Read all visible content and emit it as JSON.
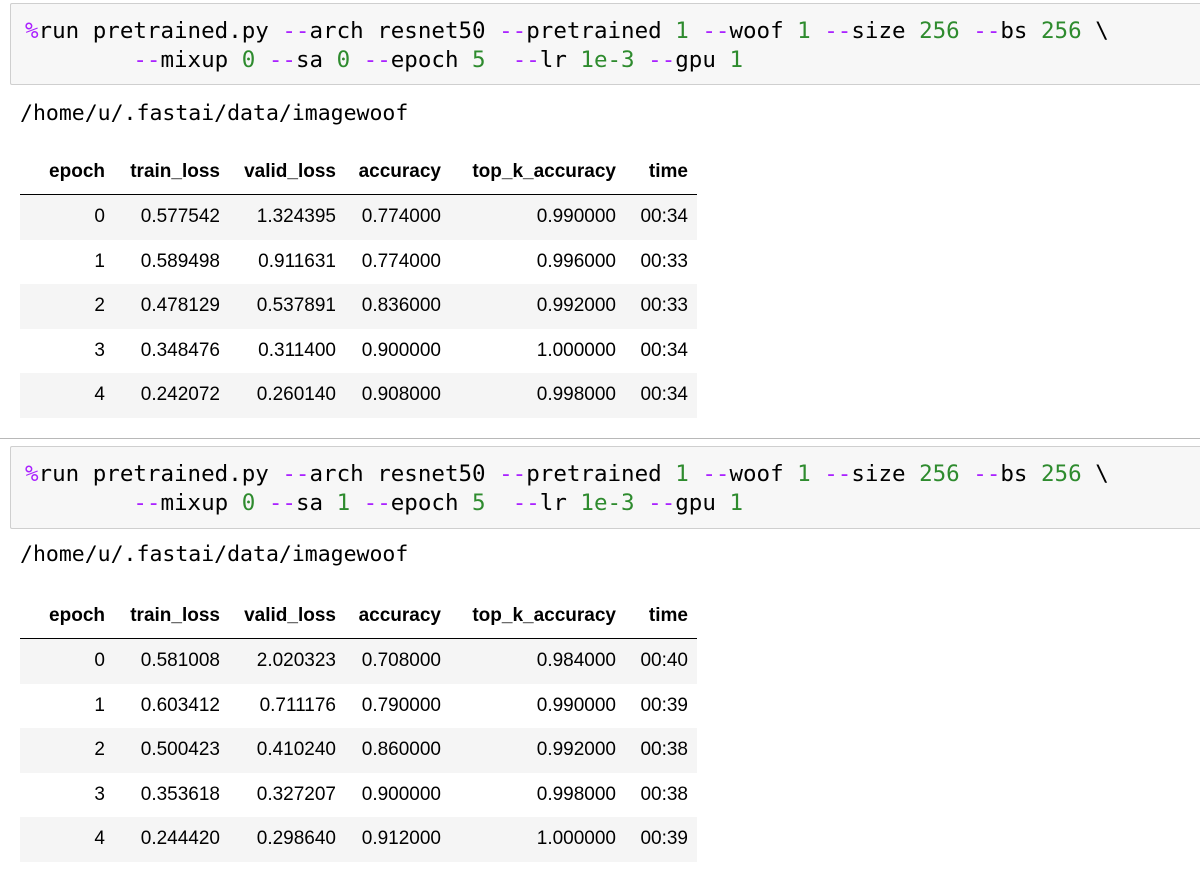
{
  "cells": [
    {
      "command": {
        "line1": [
          {
            "t": "%",
            "c": "magic"
          },
          {
            "t": "run pretrained.py ",
            "c": ""
          },
          {
            "t": "--",
            "c": "op"
          },
          {
            "t": "arch resnet50 ",
            "c": ""
          },
          {
            "t": "--",
            "c": "op"
          },
          {
            "t": "pretrained ",
            "c": ""
          },
          {
            "t": "1",
            "c": "num"
          },
          {
            "t": " ",
            "c": ""
          },
          {
            "t": "--",
            "c": "op"
          },
          {
            "t": "woof ",
            "c": ""
          },
          {
            "t": "1",
            "c": "num"
          },
          {
            "t": " ",
            "c": ""
          },
          {
            "t": "--",
            "c": "op"
          },
          {
            "t": "size ",
            "c": ""
          },
          {
            "t": "256",
            "c": "num"
          },
          {
            "t": " ",
            "c": ""
          },
          {
            "t": "--",
            "c": "op"
          },
          {
            "t": "bs ",
            "c": ""
          },
          {
            "t": "256",
            "c": "num"
          },
          {
            "t": " \\",
            "c": ""
          }
        ],
        "line2": [
          {
            "t": "        ",
            "c": ""
          },
          {
            "t": "--",
            "c": "op"
          },
          {
            "t": "mixup ",
            "c": ""
          },
          {
            "t": "0",
            "c": "num"
          },
          {
            "t": " ",
            "c": ""
          },
          {
            "t": "--",
            "c": "op"
          },
          {
            "t": "sa ",
            "c": ""
          },
          {
            "t": "0",
            "c": "num"
          },
          {
            "t": " ",
            "c": ""
          },
          {
            "t": "--",
            "c": "op"
          },
          {
            "t": "epoch ",
            "c": ""
          },
          {
            "t": "5",
            "c": "num"
          },
          {
            "t": "  ",
            "c": ""
          },
          {
            "t": "--",
            "c": "op"
          },
          {
            "t": "lr ",
            "c": ""
          },
          {
            "t": "1e-3",
            "c": "num"
          },
          {
            "t": " ",
            "c": ""
          },
          {
            "t": "--",
            "c": "op"
          },
          {
            "t": "gpu ",
            "c": ""
          },
          {
            "t": "1",
            "c": "num"
          }
        ]
      },
      "output_path": "/home/u/.fastai/data/imagewoof",
      "table": {
        "headers": [
          "epoch",
          "train_loss",
          "valid_loss",
          "accuracy",
          "top_k_accuracy",
          "time"
        ],
        "rows": [
          [
            "0",
            "0.577542",
            "1.324395",
            "0.774000",
            "0.990000",
            "00:34"
          ],
          [
            "1",
            "0.589498",
            "0.911631",
            "0.774000",
            "0.996000",
            "00:33"
          ],
          [
            "2",
            "0.478129",
            "0.537891",
            "0.836000",
            "0.992000",
            "00:33"
          ],
          [
            "3",
            "0.348476",
            "0.311400",
            "0.900000",
            "1.000000",
            "00:34"
          ],
          [
            "4",
            "0.242072",
            "0.260140",
            "0.908000",
            "0.998000",
            "00:34"
          ]
        ]
      }
    },
    {
      "command": {
        "line1": [
          {
            "t": "%",
            "c": "magic"
          },
          {
            "t": "run pretrained.py ",
            "c": ""
          },
          {
            "t": "--",
            "c": "op"
          },
          {
            "t": "arch resnet50 ",
            "c": ""
          },
          {
            "t": "--",
            "c": "op"
          },
          {
            "t": "pretrained ",
            "c": ""
          },
          {
            "t": "1",
            "c": "num"
          },
          {
            "t": " ",
            "c": ""
          },
          {
            "t": "--",
            "c": "op"
          },
          {
            "t": "woof ",
            "c": ""
          },
          {
            "t": "1",
            "c": "num"
          },
          {
            "t": " ",
            "c": ""
          },
          {
            "t": "--",
            "c": "op"
          },
          {
            "t": "size ",
            "c": ""
          },
          {
            "t": "256",
            "c": "num"
          },
          {
            "t": " ",
            "c": ""
          },
          {
            "t": "--",
            "c": "op"
          },
          {
            "t": "bs ",
            "c": ""
          },
          {
            "t": "256",
            "c": "num"
          },
          {
            "t": " \\",
            "c": ""
          }
        ],
        "line2": [
          {
            "t": "        ",
            "c": ""
          },
          {
            "t": "--",
            "c": "op"
          },
          {
            "t": "mixup ",
            "c": ""
          },
          {
            "t": "0",
            "c": "num"
          },
          {
            "t": " ",
            "c": ""
          },
          {
            "t": "--",
            "c": "op"
          },
          {
            "t": "sa ",
            "c": ""
          },
          {
            "t": "1",
            "c": "num"
          },
          {
            "t": " ",
            "c": ""
          },
          {
            "t": "--",
            "c": "op"
          },
          {
            "t": "epoch ",
            "c": ""
          },
          {
            "t": "5",
            "c": "num"
          },
          {
            "t": "  ",
            "c": ""
          },
          {
            "t": "--",
            "c": "op"
          },
          {
            "t": "lr ",
            "c": ""
          },
          {
            "t": "1e-3",
            "c": "num"
          },
          {
            "t": " ",
            "c": ""
          },
          {
            "t": "--",
            "c": "op"
          },
          {
            "t": "gpu ",
            "c": ""
          },
          {
            "t": "1",
            "c": "num"
          }
        ]
      },
      "output_path": "/home/u/.fastai/data/imagewoof",
      "table": {
        "headers": [
          "epoch",
          "train_loss",
          "valid_loss",
          "accuracy",
          "top_k_accuracy",
          "time"
        ],
        "rows": [
          [
            "0",
            "0.581008",
            "2.020323",
            "0.708000",
            "0.984000",
            "00:40"
          ],
          [
            "1",
            "0.603412",
            "0.711176",
            "0.790000",
            "0.990000",
            "00:39"
          ],
          [
            "2",
            "0.500423",
            "0.410240",
            "0.860000",
            "0.992000",
            "00:38"
          ],
          [
            "3",
            "0.353618",
            "0.327207",
            "0.900000",
            "0.998000",
            "00:38"
          ],
          [
            "4",
            "0.244420",
            "0.298640",
            "0.912000",
            "1.000000",
            "00:39"
          ]
        ]
      }
    }
  ],
  "colors": {
    "magic": "#aa22ff",
    "operator": "#aa22ff",
    "number": "#2e8b2e",
    "input_bg": "#f7f7f7",
    "row_stripe": "#f5f5f5"
  }
}
